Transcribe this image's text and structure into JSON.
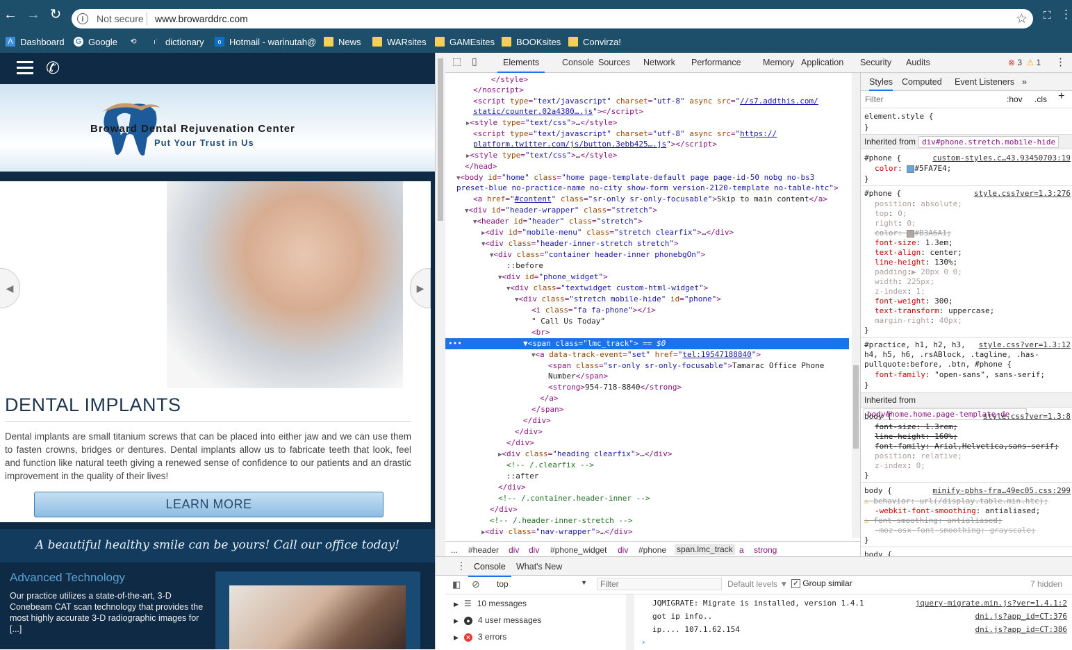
{
  "browser": {
    "security": "Not secure",
    "url": "www.browarddrc.com",
    "bookmarks": [
      {
        "label": "Dashboard",
        "icon": "dashboard-icon"
      },
      {
        "label": "Google",
        "icon": "google-icon"
      },
      {
        "label": "",
        "icon": "history-icon"
      },
      {
        "label": "dictionary",
        "icon": "dictionary-icon"
      },
      {
        "label": "Hotmail - warinutah@",
        "icon": "outlook-icon"
      },
      {
        "label": "News",
        "icon": "folder-icon"
      },
      {
        "label": "WARsites",
        "icon": "folder-icon"
      },
      {
        "label": "GAMEsites",
        "icon": "folder-icon"
      },
      {
        "label": "BOOKsites",
        "icon": "folder-icon"
      },
      {
        "label": "Convirza!",
        "icon": "folder-icon"
      }
    ]
  },
  "site": {
    "logo_name": "Broward Dental Rejuvenation Center",
    "logo_tagline": "Put Your Trust in Us",
    "heading": "DENTAL IMPLANTS",
    "body": "Dental implants are small titanium screws that can be placed into either jaw and we can use them to fasten crowns, bridges or dentures. Dental implants allow us to fabricate teeth that look, feel and function like natural teeth giving a renewed sense of confidence to our patients and an drastic improvement in the quality of their lives!",
    "learn_more": "LEARN MORE",
    "banner": "A beautiful healthy smile can be yours!  Call our office today!",
    "feature_title": "Advanced Technology",
    "feature_text": "Our practice utilizes a state-of-the-art, 3-D Conebeam CAT scan technology that provides the most highly accurate 3-D radiographic images for [...]"
  },
  "devtools": {
    "tabs": [
      "Elements",
      "Console",
      "Sources",
      "Network",
      "Performance",
      "Memory",
      "Application",
      "Security",
      "Audits"
    ],
    "errors": "3",
    "warnings": "1",
    "breadcrumbs": [
      "...",
      "#header",
      "div",
      "div",
      "#phone_widget",
      "div",
      "#phone",
      "span.lmc_track",
      "a",
      "strong"
    ],
    "styles_tabs": [
      "Styles",
      "Computed",
      "Event Listeners",
      "»"
    ],
    "styles_filter_placeholder": "Filter",
    "hov": ":hov",
    "cls": ".cls",
    "inherited_1": "div#phone.stretch.mobile-hide",
    "inherited_2": "body#home.home.page-template-de...",
    "inherited_label": "Inherited from",
    "drawer_tabs": [
      "Console",
      "What's New"
    ],
    "context": "top",
    "console_filter_placeholder": "Filter",
    "default_levels": "Default levels ▼",
    "group_similar": "Group similar",
    "hidden": "7 hidden",
    "sidebar": [
      {
        "label": "10 messages",
        "icon": "list-icon"
      },
      {
        "label": "4 user messages",
        "icon": "user-icon"
      },
      {
        "label": "3 errors",
        "icon": "error-icon"
      }
    ],
    "console_lines": [
      {
        "text": "JQMIGRATE: Migrate is installed, version 1.4.1",
        "source": "jquery-migrate.min.js?ver=1.4.1:2"
      },
      {
        "text": "got ip info..",
        "source": "dni.js?app_id=CT:376"
      },
      {
        "text": "ip.... 107.1.62.154",
        "source": "dni.js?app_id=CT:386"
      }
    ]
  },
  "colors": {
    "browser_chrome": "#1d4f6a",
    "selection": "#1a73e8",
    "phone_color": "#5FA7E4",
    "old_color": "#B3A6A1"
  }
}
